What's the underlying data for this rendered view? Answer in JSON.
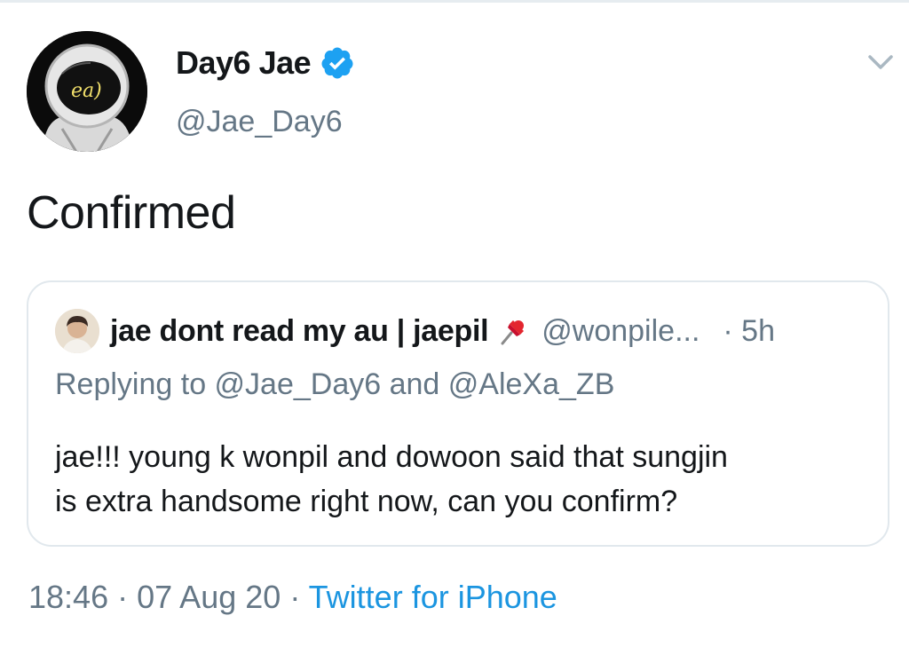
{
  "tweet": {
    "author": {
      "display_name": "Day6 Jae",
      "handle": "@Jae_Day6",
      "verified": true,
      "avatar_text": "ea)"
    },
    "text": "Confirmed",
    "timestamp_time": "18:46",
    "timestamp_date": "07 Aug 20",
    "separator": "·",
    "source": "Twitter for iPhone"
  },
  "quoted_tweet": {
    "author_name": "jae dont read my au | jaepil",
    "name_emoji": "pushpin-icon",
    "handle": "@wonpile...",
    "time": "· 5h",
    "replying_to": "Replying to @Jae_Day6 and @AleXa_ZB",
    "text_line1": "jae!!! young k wonpil and dowoon said that sungjin",
    "text_line2": "is extra handsome right now, can you confirm?"
  },
  "icons": {
    "verified": "verified-badge-icon",
    "more": "chevron-down-icon"
  },
  "colors": {
    "verified_blue": "#1da1f2",
    "link_blue": "#1b95e0",
    "secondary_text": "#657786",
    "border": "#e1e8ed"
  }
}
